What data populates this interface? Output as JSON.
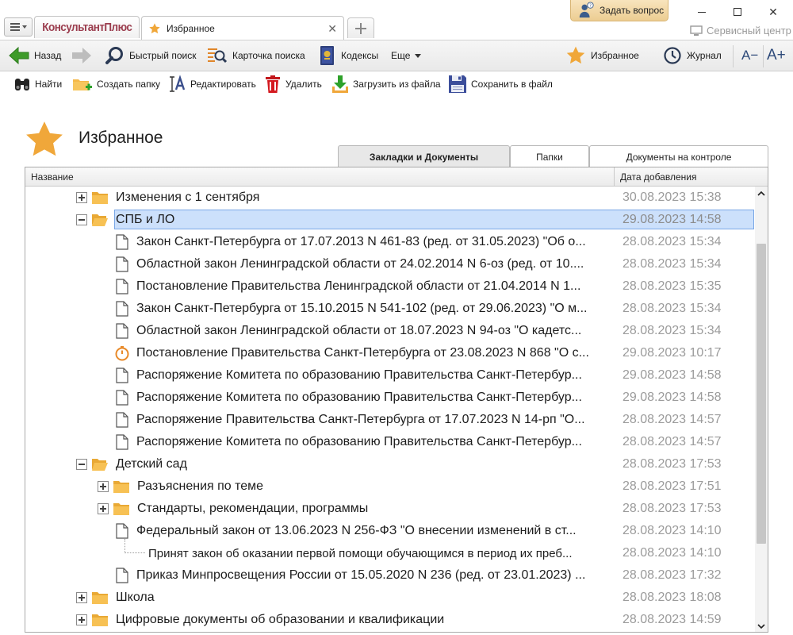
{
  "window": {
    "logo": "КонсультантПлюс",
    "active_tab": "Избранное",
    "ask_question": "Задать вопрос",
    "service_center": "Сервисный центр"
  },
  "nav": {
    "back": "Назад",
    "quick_search": "Быстрый поиск",
    "search_card": "Карточка поиска",
    "codes": "Кодексы",
    "more": "Еще",
    "favorites": "Избранное",
    "journal": "Журнал",
    "font_smaller": "A−",
    "font_larger": "A+"
  },
  "actions": {
    "find": "Найти",
    "create_folder": "Создать папку",
    "edit": "Редактировать",
    "delete": "Удалить",
    "load_from_file": "Загрузить из файла",
    "save_to_file": "Сохранить в файл"
  },
  "page": {
    "title": "Избранное"
  },
  "view_tabs": [
    "Закладки и Документы",
    "Папки",
    "Документы на контроле"
  ],
  "table": {
    "columns": [
      "Название",
      "Дата добавления"
    ],
    "rows": [
      {
        "type": "folder",
        "level": 0,
        "toggle": "plus",
        "name": "Изменения с 1 сентября",
        "date": "30.08.2023 15:38"
      },
      {
        "type": "folder-open",
        "level": 0,
        "toggle": "minus",
        "name": "СПБ и ЛО",
        "date": "29.08.2023 14:58",
        "selected": true
      },
      {
        "type": "doc",
        "level": 1,
        "name": "Закон Санкт-Петербурга от 17.07.2013 N 461-83 (ред. от 31.05.2023) \"Об о...",
        "date": "28.08.2023 15:34"
      },
      {
        "type": "doc",
        "level": 1,
        "name": "Областной закон Ленинградской области от 24.02.2014 N 6-оз (ред. от 10....",
        "date": "28.08.2023 15:34"
      },
      {
        "type": "doc",
        "level": 1,
        "name": "Постановление Правительства Ленинградской области от 21.04.2014 N 1...",
        "date": "28.08.2023 15:35"
      },
      {
        "type": "doc",
        "level": 1,
        "name": "Закон Санкт-Петербурга от 15.10.2015 N 541-102 (ред. от 29.06.2023) \"О м...",
        "date": "28.08.2023 15:34"
      },
      {
        "type": "doc",
        "level": 1,
        "name": "Областной закон Ленинградской области от 18.07.2023 N 94-оз \"О кадетс...",
        "date": "28.08.2023 15:34"
      },
      {
        "type": "timer",
        "level": 1,
        "name": "Постановление Правительства Санкт-Петербурга от 23.08.2023 N 868 \"О с...",
        "date": "29.08.2023 10:17"
      },
      {
        "type": "doc",
        "level": 1,
        "name": "Распоряжение Комитета по образованию Правительства Санкт-Петербур...",
        "date": "29.08.2023 14:58"
      },
      {
        "type": "doc",
        "level": 1,
        "name": "Распоряжение Комитета по образованию Правительства Санкт-Петербур...",
        "date": "29.08.2023 14:58"
      },
      {
        "type": "doc",
        "level": 1,
        "name": "Распоряжение Правительства Санкт-Петербурга от 17.07.2023 N 14-рп \"О...",
        "date": "28.08.2023 14:57"
      },
      {
        "type": "doc",
        "level": 1,
        "name": "Распоряжение Комитета по образованию Правительства Санкт-Петербур...",
        "date": "28.08.2023 14:57"
      },
      {
        "type": "folder-open",
        "level": 0,
        "toggle": "minus",
        "name": "Детский сад",
        "date": "28.08.2023 17:53"
      },
      {
        "type": "folder",
        "level": 1,
        "toggle": "plus",
        "name": "Разъяснения по теме",
        "date": "28.08.2023 17:51"
      },
      {
        "type": "folder",
        "level": 1,
        "toggle": "plus",
        "name": "Стандарты, рекомендации, программы",
        "date": "28.08.2023 17:53"
      },
      {
        "type": "doc",
        "level": 1,
        "name": "Федеральный закон от 13.06.2023 N 256-ФЗ \"О внесении изменений в ст...",
        "date": "28.08.2023 14:10"
      },
      {
        "type": "note",
        "level": 2,
        "name": "Принят закон об оказании первой помощи обучающимся в период их преб...",
        "date": "28.08.2023 14:10"
      },
      {
        "type": "doc",
        "level": 1,
        "name": "Приказ Минпросвещения России от 15.05.2020 N 236 (ред. от 23.01.2023) ...",
        "date": "28.08.2023 17:32"
      },
      {
        "type": "folder",
        "level": 0,
        "toggle": "plus",
        "name": "Школа",
        "date": "28.08.2023 18:08"
      },
      {
        "type": "folder",
        "level": 0,
        "toggle": "plus",
        "name": "Цифровые документы об образовании и квалификации",
        "date": "28.08.2023 14:59"
      }
    ]
  },
  "colors": {
    "star": "#f0a73a",
    "folder": "#f7c154",
    "selection": "#cce0fb",
    "date_text": "#9b9b9b"
  }
}
